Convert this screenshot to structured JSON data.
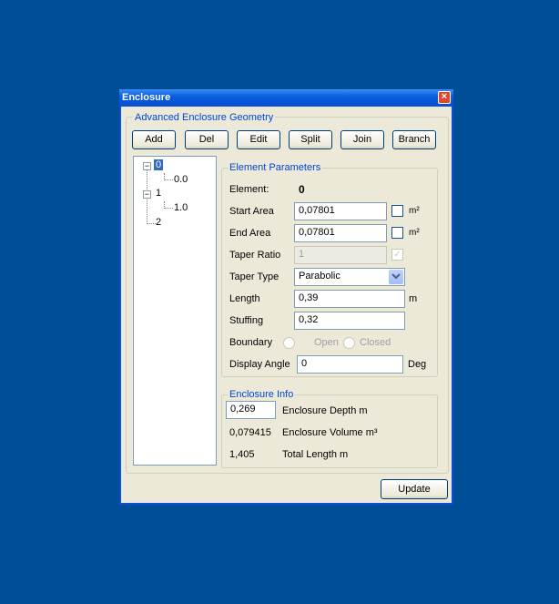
{
  "window": {
    "title": "Enclosure",
    "close_label": "×"
  },
  "geometry": {
    "legend": "Advanced Enclosure Geometry",
    "buttons": {
      "add": "Add",
      "del": "Del",
      "edit": "Edit",
      "split": "Split",
      "join": "Join",
      "branch": "Branch"
    }
  },
  "tree": {
    "items": [
      {
        "label": "0",
        "expander": "−",
        "selected": true
      },
      {
        "label": "0.0"
      },
      {
        "label": "1",
        "expander": "−"
      },
      {
        "label": "1.0"
      },
      {
        "label": "2"
      }
    ]
  },
  "params": {
    "legend": "Element Parameters",
    "element_label": "Element:",
    "element_value": "0",
    "start_area_label": "Start Area",
    "start_area_value": "0,07801",
    "start_area_unit": "m²",
    "end_area_label": "End Area",
    "end_area_value": "0,07801",
    "end_area_unit": "m²",
    "taper_ratio_label": "Taper Ratio",
    "taper_ratio_value": "1",
    "taper_ratio_checked": "✓",
    "taper_type_label": "Taper Type",
    "taper_type_value": "Parabolic",
    "length_label": "Length",
    "length_value": "0,39",
    "length_unit": "m",
    "stuffing_label": "Stuffing",
    "stuffing_value": "0,32",
    "boundary_label": "Boundary",
    "boundary_open": "Open",
    "boundary_closed": "Closed",
    "display_angle_label": "Display Angle",
    "display_angle_value": "0",
    "display_angle_unit": "Deg"
  },
  "info": {
    "legend": "Enclosure Info",
    "depth_value": "0,269",
    "depth_label": "Enclosure Depth m",
    "volume_value": "0,079415",
    "volume_label": "Enclosure Volume m³",
    "length_value": "1,405",
    "length_label": "Total Length m"
  },
  "update_label": "Update"
}
